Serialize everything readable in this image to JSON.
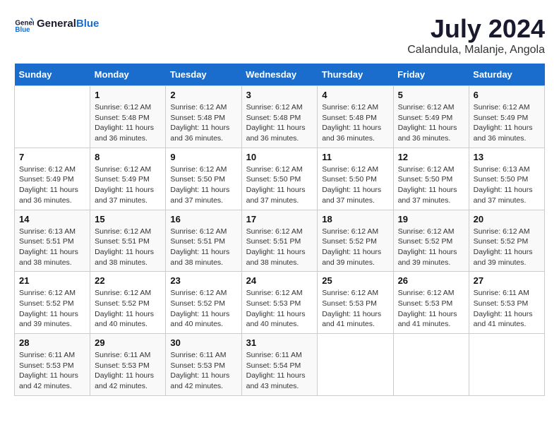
{
  "logo": {
    "text_general": "General",
    "text_blue": "Blue"
  },
  "title": "July 2024",
  "subtitle": "Calandula, Malanje, Angola",
  "days_of_week": [
    "Sunday",
    "Monday",
    "Tuesday",
    "Wednesday",
    "Thursday",
    "Friday",
    "Saturday"
  ],
  "weeks": [
    [
      {
        "day": "",
        "info": ""
      },
      {
        "day": "1",
        "info": "Sunrise: 6:12 AM\nSunset: 5:48 PM\nDaylight: 11 hours\nand 36 minutes."
      },
      {
        "day": "2",
        "info": "Sunrise: 6:12 AM\nSunset: 5:48 PM\nDaylight: 11 hours\nand 36 minutes."
      },
      {
        "day": "3",
        "info": "Sunrise: 6:12 AM\nSunset: 5:48 PM\nDaylight: 11 hours\nand 36 minutes."
      },
      {
        "day": "4",
        "info": "Sunrise: 6:12 AM\nSunset: 5:48 PM\nDaylight: 11 hours\nand 36 minutes."
      },
      {
        "day": "5",
        "info": "Sunrise: 6:12 AM\nSunset: 5:49 PM\nDaylight: 11 hours\nand 36 minutes."
      },
      {
        "day": "6",
        "info": "Sunrise: 6:12 AM\nSunset: 5:49 PM\nDaylight: 11 hours\nand 36 minutes."
      }
    ],
    [
      {
        "day": "7",
        "info": "Sunrise: 6:12 AM\nSunset: 5:49 PM\nDaylight: 11 hours\nand 36 minutes."
      },
      {
        "day": "8",
        "info": "Sunrise: 6:12 AM\nSunset: 5:49 PM\nDaylight: 11 hours\nand 37 minutes."
      },
      {
        "day": "9",
        "info": "Sunrise: 6:12 AM\nSunset: 5:50 PM\nDaylight: 11 hours\nand 37 minutes."
      },
      {
        "day": "10",
        "info": "Sunrise: 6:12 AM\nSunset: 5:50 PM\nDaylight: 11 hours\nand 37 minutes."
      },
      {
        "day": "11",
        "info": "Sunrise: 6:12 AM\nSunset: 5:50 PM\nDaylight: 11 hours\nand 37 minutes."
      },
      {
        "day": "12",
        "info": "Sunrise: 6:12 AM\nSunset: 5:50 PM\nDaylight: 11 hours\nand 37 minutes."
      },
      {
        "day": "13",
        "info": "Sunrise: 6:13 AM\nSunset: 5:50 PM\nDaylight: 11 hours\nand 37 minutes."
      }
    ],
    [
      {
        "day": "14",
        "info": "Sunrise: 6:13 AM\nSunset: 5:51 PM\nDaylight: 11 hours\nand 38 minutes."
      },
      {
        "day": "15",
        "info": "Sunrise: 6:12 AM\nSunset: 5:51 PM\nDaylight: 11 hours\nand 38 minutes."
      },
      {
        "day": "16",
        "info": "Sunrise: 6:12 AM\nSunset: 5:51 PM\nDaylight: 11 hours\nand 38 minutes."
      },
      {
        "day": "17",
        "info": "Sunrise: 6:12 AM\nSunset: 5:51 PM\nDaylight: 11 hours\nand 38 minutes."
      },
      {
        "day": "18",
        "info": "Sunrise: 6:12 AM\nSunset: 5:52 PM\nDaylight: 11 hours\nand 39 minutes."
      },
      {
        "day": "19",
        "info": "Sunrise: 6:12 AM\nSunset: 5:52 PM\nDaylight: 11 hours\nand 39 minutes."
      },
      {
        "day": "20",
        "info": "Sunrise: 6:12 AM\nSunset: 5:52 PM\nDaylight: 11 hours\nand 39 minutes."
      }
    ],
    [
      {
        "day": "21",
        "info": "Sunrise: 6:12 AM\nSunset: 5:52 PM\nDaylight: 11 hours\nand 39 minutes."
      },
      {
        "day": "22",
        "info": "Sunrise: 6:12 AM\nSunset: 5:52 PM\nDaylight: 11 hours\nand 40 minutes."
      },
      {
        "day": "23",
        "info": "Sunrise: 6:12 AM\nSunset: 5:52 PM\nDaylight: 11 hours\nand 40 minutes."
      },
      {
        "day": "24",
        "info": "Sunrise: 6:12 AM\nSunset: 5:53 PM\nDaylight: 11 hours\nand 40 minutes."
      },
      {
        "day": "25",
        "info": "Sunrise: 6:12 AM\nSunset: 5:53 PM\nDaylight: 11 hours\nand 41 minutes."
      },
      {
        "day": "26",
        "info": "Sunrise: 6:12 AM\nSunset: 5:53 PM\nDaylight: 11 hours\nand 41 minutes."
      },
      {
        "day": "27",
        "info": "Sunrise: 6:11 AM\nSunset: 5:53 PM\nDaylight: 11 hours\nand 41 minutes."
      }
    ],
    [
      {
        "day": "28",
        "info": "Sunrise: 6:11 AM\nSunset: 5:53 PM\nDaylight: 11 hours\nand 42 minutes."
      },
      {
        "day": "29",
        "info": "Sunrise: 6:11 AM\nSunset: 5:53 PM\nDaylight: 11 hours\nand 42 minutes."
      },
      {
        "day": "30",
        "info": "Sunrise: 6:11 AM\nSunset: 5:53 PM\nDaylight: 11 hours\nand 42 minutes."
      },
      {
        "day": "31",
        "info": "Sunrise: 6:11 AM\nSunset: 5:54 PM\nDaylight: 11 hours\nand 43 minutes."
      },
      {
        "day": "",
        "info": ""
      },
      {
        "day": "",
        "info": ""
      },
      {
        "day": "",
        "info": ""
      }
    ]
  ]
}
